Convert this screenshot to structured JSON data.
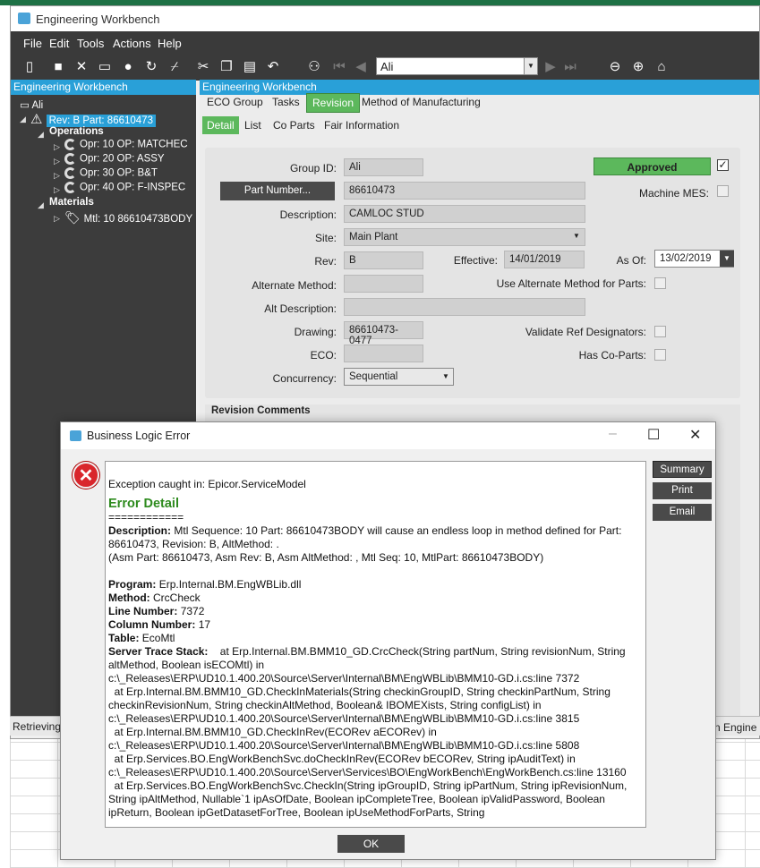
{
  "window": {
    "title": "Engineering Workbench"
  },
  "menu": [
    "File",
    "Edit",
    "Tools",
    "Actions",
    "Help"
  ],
  "toolbar": {
    "nav_value": "Ali"
  },
  "tree": {
    "header": "Engineering Workbench",
    "root": "Ali",
    "rev_node": "Rev: B Part: 86610473",
    "operations_label": "Operations",
    "operations": [
      "Opr: 10 OP: MATCHEC",
      "Opr: 20 OP: ASSY",
      "Opr: 30 OP: B&T",
      "Opr: 40 OP: F-INSPEC"
    ],
    "materials_label": "Materials",
    "materials": [
      "Mtl: 10 86610473BODY"
    ]
  },
  "panel": {
    "header": "Engineering Workbench",
    "tabs": [
      "ECO Group",
      "Tasks",
      "Revision",
      "Method of Manufacturing"
    ],
    "subtabs": [
      "Detail",
      "List",
      "Co Parts",
      "Fair Information"
    ]
  },
  "form": {
    "group_id_label": "Group ID:",
    "group_id": "Ali",
    "part_number_btn": "Part Number...",
    "part_number": "86610473",
    "description_label": "Description:",
    "description": "CAMLOC STUD",
    "site_label": "Site:",
    "site": "Main Plant",
    "rev_label": "Rev:",
    "rev": "B",
    "effective_label": "Effective:",
    "effective": "14/01/2019",
    "as_of_label": "As Of:",
    "as_of": "13/02/2019",
    "alt_method_label": "Alternate Method:",
    "use_alt_label": "Use Alternate Method for Parts:",
    "alt_desc_label": "Alt Description:",
    "drawing_label": "Drawing:",
    "drawing": "86610473-0477",
    "validate_label": "Validate Ref Designators:",
    "eco_label": "ECO:",
    "has_coparts_label": "Has Co-Parts:",
    "concurrency_label": "Concurrency:",
    "concurrency": "Sequential",
    "approved": "Approved",
    "machine_mes_label": "Machine MES:",
    "revision_comments": "Revision Comments"
  },
  "status": {
    "left": "Retrieving",
    "right": "n Engine"
  },
  "dialog": {
    "title": "Business Logic Error",
    "exception": "Exception caught in: Epicor.ServiceModel",
    "error_detail": "Error Detail",
    "separator": "============",
    "desc_label": "Description:",
    "desc_text": "Mtl Sequence: 10 Part: 86610473BODY will cause an endless loop in method defined for Part: 86610473, Revision: B, AltMethod: .",
    "asm_text": "(Asm Part: 86610473, Asm Rev: B,  Asm AltMethod: , Mtl Seq: 10, MtlPart: 86610473BODY)",
    "program_label": "Program:",
    "program": "Erp.Internal.BM.EngWBLib.dll",
    "method_label": "Method:",
    "method": "CrcCheck",
    "line_label": "Line Number:",
    "line": "7372",
    "column_label": "Column Number:",
    "column": "17",
    "table_label": "Table:",
    "table": "EcoMtl",
    "stack_label": "Server Trace Stack:",
    "stack": [
      "at Erp.Internal.BM.BMM10_GD.CrcCheck(String partNum, String revisionNum, String altMethod, Boolean isECOMtl) in c:\\_Releases\\ERP\\UD10.1.400.20\\Source\\Server\\Internal\\BM\\EngWBLib\\BMM10-GD.i.cs:line 7372",
      "at Erp.Internal.BM.BMM10_GD.CheckInMaterials(String checkinGroupID, String checkinPartNum, String checkinRevisionNum, String checkinAltMethod, Boolean& IBOMEXists, String configList) in c:\\_Releases\\ERP\\UD10.1.400.20\\Source\\Server\\Internal\\BM\\EngWBLib\\BMM10-GD.i.cs:line 3815",
      "at Erp.Internal.BM.BMM10_GD.CheckInRev(ECORev aECORev) in c:\\_Releases\\ERP\\UD10.1.400.20\\Source\\Server\\Internal\\BM\\EngWBLib\\BMM10-GD.i.cs:line 5808",
      "at Erp.Services.BO.EngWorkBenchSvc.doCheckInRev(ECORev bECORev, String ipAuditText) in c:\\_Releases\\ERP\\UD10.1.400.20\\Source\\Server\\Services\\BO\\EngWorkBench\\EngWorkBench.cs:line 13160",
      "at Erp.Services.BO.EngWorkBenchSvc.CheckIn(String ipGroupID, String ipPartNum, String ipRevisionNum, String ipAltMethod, Nullable`1 ipAsOfDate, Boolean ipCompleteTree, Boolean ipValidPassword, Boolean ipReturn, Boolean ipGetDatasetForTree, Boolean ipUseMethodForParts, String"
    ],
    "buttons": {
      "summary": "Summary",
      "print": "Print",
      "email": "Email",
      "ok": "OK"
    }
  }
}
